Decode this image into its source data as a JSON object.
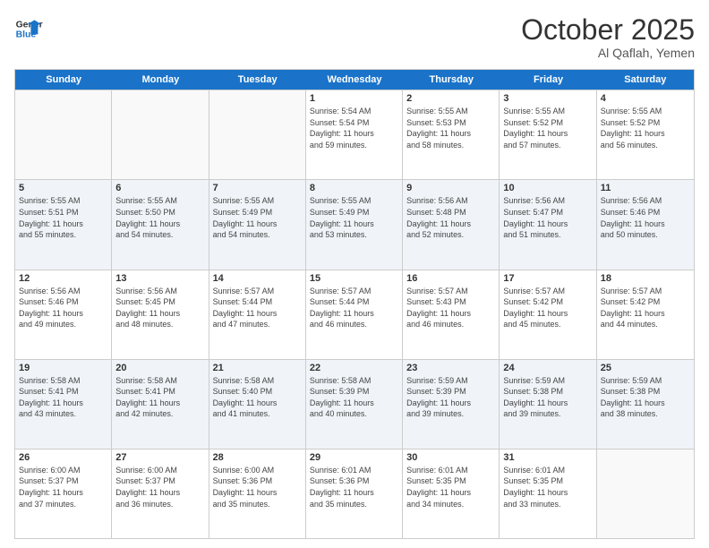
{
  "header": {
    "logo_line1": "General",
    "logo_line2": "Blue",
    "month": "October 2025",
    "location": "Al Qaflah, Yemen"
  },
  "weekdays": [
    "Sunday",
    "Monday",
    "Tuesday",
    "Wednesday",
    "Thursday",
    "Friday",
    "Saturday"
  ],
  "rows": [
    [
      {
        "day": "",
        "info": "",
        "empty": true
      },
      {
        "day": "",
        "info": "",
        "empty": true
      },
      {
        "day": "",
        "info": "",
        "empty": true
      },
      {
        "day": "1",
        "info": "Sunrise: 5:54 AM\nSunset: 5:54 PM\nDaylight: 11 hours\nand 59 minutes.",
        "empty": false
      },
      {
        "day": "2",
        "info": "Sunrise: 5:55 AM\nSunset: 5:53 PM\nDaylight: 11 hours\nand 58 minutes.",
        "empty": false
      },
      {
        "day": "3",
        "info": "Sunrise: 5:55 AM\nSunset: 5:52 PM\nDaylight: 11 hours\nand 57 minutes.",
        "empty": false
      },
      {
        "day": "4",
        "info": "Sunrise: 5:55 AM\nSunset: 5:52 PM\nDaylight: 11 hours\nand 56 minutes.",
        "empty": false
      }
    ],
    [
      {
        "day": "5",
        "info": "Sunrise: 5:55 AM\nSunset: 5:51 PM\nDaylight: 11 hours\nand 55 minutes.",
        "empty": false
      },
      {
        "day": "6",
        "info": "Sunrise: 5:55 AM\nSunset: 5:50 PM\nDaylight: 11 hours\nand 54 minutes.",
        "empty": false
      },
      {
        "day": "7",
        "info": "Sunrise: 5:55 AM\nSunset: 5:49 PM\nDaylight: 11 hours\nand 54 minutes.",
        "empty": false
      },
      {
        "day": "8",
        "info": "Sunrise: 5:55 AM\nSunset: 5:49 PM\nDaylight: 11 hours\nand 53 minutes.",
        "empty": false
      },
      {
        "day": "9",
        "info": "Sunrise: 5:56 AM\nSunset: 5:48 PM\nDaylight: 11 hours\nand 52 minutes.",
        "empty": false
      },
      {
        "day": "10",
        "info": "Sunrise: 5:56 AM\nSunset: 5:47 PM\nDaylight: 11 hours\nand 51 minutes.",
        "empty": false
      },
      {
        "day": "11",
        "info": "Sunrise: 5:56 AM\nSunset: 5:46 PM\nDaylight: 11 hours\nand 50 minutes.",
        "empty": false
      }
    ],
    [
      {
        "day": "12",
        "info": "Sunrise: 5:56 AM\nSunset: 5:46 PM\nDaylight: 11 hours\nand 49 minutes.",
        "empty": false
      },
      {
        "day": "13",
        "info": "Sunrise: 5:56 AM\nSunset: 5:45 PM\nDaylight: 11 hours\nand 48 minutes.",
        "empty": false
      },
      {
        "day": "14",
        "info": "Sunrise: 5:57 AM\nSunset: 5:44 PM\nDaylight: 11 hours\nand 47 minutes.",
        "empty": false
      },
      {
        "day": "15",
        "info": "Sunrise: 5:57 AM\nSunset: 5:44 PM\nDaylight: 11 hours\nand 46 minutes.",
        "empty": false
      },
      {
        "day": "16",
        "info": "Sunrise: 5:57 AM\nSunset: 5:43 PM\nDaylight: 11 hours\nand 46 minutes.",
        "empty": false
      },
      {
        "day": "17",
        "info": "Sunrise: 5:57 AM\nSunset: 5:42 PM\nDaylight: 11 hours\nand 45 minutes.",
        "empty": false
      },
      {
        "day": "18",
        "info": "Sunrise: 5:57 AM\nSunset: 5:42 PM\nDaylight: 11 hours\nand 44 minutes.",
        "empty": false
      }
    ],
    [
      {
        "day": "19",
        "info": "Sunrise: 5:58 AM\nSunset: 5:41 PM\nDaylight: 11 hours\nand 43 minutes.",
        "empty": false
      },
      {
        "day": "20",
        "info": "Sunrise: 5:58 AM\nSunset: 5:41 PM\nDaylight: 11 hours\nand 42 minutes.",
        "empty": false
      },
      {
        "day": "21",
        "info": "Sunrise: 5:58 AM\nSunset: 5:40 PM\nDaylight: 11 hours\nand 41 minutes.",
        "empty": false
      },
      {
        "day": "22",
        "info": "Sunrise: 5:58 AM\nSunset: 5:39 PM\nDaylight: 11 hours\nand 40 minutes.",
        "empty": false
      },
      {
        "day": "23",
        "info": "Sunrise: 5:59 AM\nSunset: 5:39 PM\nDaylight: 11 hours\nand 39 minutes.",
        "empty": false
      },
      {
        "day": "24",
        "info": "Sunrise: 5:59 AM\nSunset: 5:38 PM\nDaylight: 11 hours\nand 39 minutes.",
        "empty": false
      },
      {
        "day": "25",
        "info": "Sunrise: 5:59 AM\nSunset: 5:38 PM\nDaylight: 11 hours\nand 38 minutes.",
        "empty": false
      }
    ],
    [
      {
        "day": "26",
        "info": "Sunrise: 6:00 AM\nSunset: 5:37 PM\nDaylight: 11 hours\nand 37 minutes.",
        "empty": false
      },
      {
        "day": "27",
        "info": "Sunrise: 6:00 AM\nSunset: 5:37 PM\nDaylight: 11 hours\nand 36 minutes.",
        "empty": false
      },
      {
        "day": "28",
        "info": "Sunrise: 6:00 AM\nSunset: 5:36 PM\nDaylight: 11 hours\nand 35 minutes.",
        "empty": false
      },
      {
        "day": "29",
        "info": "Sunrise: 6:01 AM\nSunset: 5:36 PM\nDaylight: 11 hours\nand 35 minutes.",
        "empty": false
      },
      {
        "day": "30",
        "info": "Sunrise: 6:01 AM\nSunset: 5:35 PM\nDaylight: 11 hours\nand 34 minutes.",
        "empty": false
      },
      {
        "day": "31",
        "info": "Sunrise: 6:01 AM\nSunset: 5:35 PM\nDaylight: 11 hours\nand 33 minutes.",
        "empty": false
      },
      {
        "day": "",
        "info": "",
        "empty": true
      }
    ]
  ]
}
